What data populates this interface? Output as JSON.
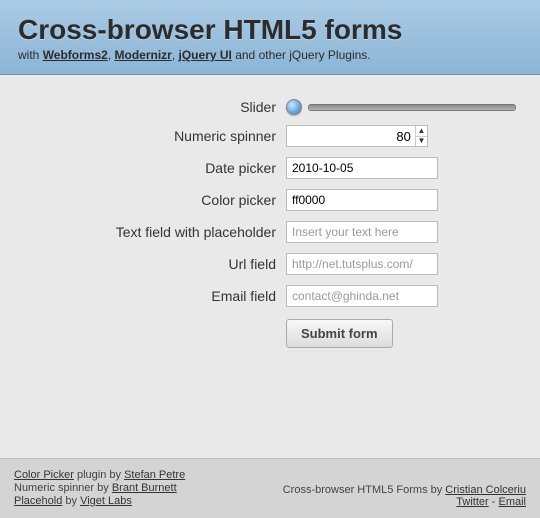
{
  "header": {
    "title": "Cross-browser HTML5 forms",
    "sub_prefix": "with ",
    "links": [
      "Webforms2",
      "Modernizr",
      "jQuery UI"
    ],
    "sub_sep": ", ",
    "sub_suffix": " and other jQuery Plugins."
  },
  "form": {
    "slider": {
      "label": "Slider"
    },
    "spinner": {
      "label": "Numeric spinner",
      "value": "80"
    },
    "date": {
      "label": "Date picker",
      "value": "2010-10-05"
    },
    "color": {
      "label": "Color picker",
      "value": "ff0000"
    },
    "text_ph": {
      "label": "Text field with placeholder",
      "placeholder": "Insert your text here"
    },
    "url": {
      "label": "Url field",
      "placeholder": "http://net.tutsplus.com/"
    },
    "email": {
      "label": "Email field",
      "placeholder": "contact@ghinda.net"
    },
    "submit": "Submit form"
  },
  "footer": {
    "line1_a": "Color Picker",
    "line1_mid": " plugin by ",
    "line1_b": "Stefan Petre",
    "line2_a": "Numeric spinner by ",
    "line2_b": "Brant Burnett",
    "line3_a": "Placehold",
    "line3_mid": " by ",
    "line3_b": "Viget Labs",
    "right1_a": "Cross-browser HTML5 Forms by ",
    "right1_b": "Cristian Colceriu",
    "right2_a": "Twitter",
    "right2_sep": " - ",
    "right2_b": "Email"
  }
}
